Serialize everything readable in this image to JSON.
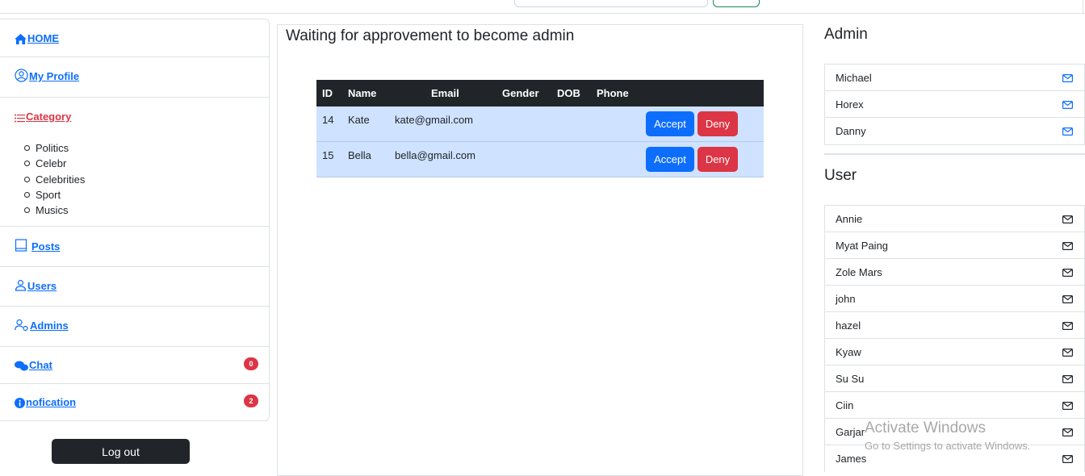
{
  "sidebar": {
    "home": "HOME",
    "profile": "My Profile",
    "category": "Category",
    "categories": [
      "Politics",
      "Celebr",
      "Celebrities",
      "Sport",
      "Musics"
    ],
    "posts": "Posts",
    "users": "Users",
    "admins": "Admins",
    "chat": "Chat",
    "chat_badge": "0",
    "notification": "nofication",
    "notification_badge": "2",
    "logout": "Log out"
  },
  "main": {
    "title": "Waiting for approvement to become admin",
    "columns": [
      "ID",
      "Name",
      "Email",
      "Gender",
      "DOB",
      "Phone"
    ],
    "rows": [
      {
        "id": "14",
        "name": "Kate",
        "email": "kate@gmail.com",
        "gender": "",
        "dob": "",
        "phone": ""
      },
      {
        "id": "15",
        "name": "Bella",
        "email": "bella@gmail.com",
        "gender": "",
        "dob": "",
        "phone": ""
      }
    ],
    "accept_label": "Accept",
    "deny_label": "Deny"
  },
  "admins": {
    "heading": "Admin",
    "items": [
      "Michael",
      "Horex",
      "Danny"
    ]
  },
  "users": {
    "heading": "User",
    "items": [
      "Annie",
      "Myat Paing",
      "Zole Mars",
      "john",
      "hazel",
      "Kyaw",
      "Su Su",
      "Ciin",
      "Garjar",
      "James"
    ]
  },
  "watermark": {
    "line1": "Activate Windows",
    "line2": "Go to Settings to activate Windows."
  },
  "colors": {
    "primary": "#0d6efd",
    "danger": "#dc3545",
    "dark": "#212529",
    "row_bg": "#cfe2ff"
  },
  "icons": {
    "home": "home-icon",
    "profile": "user-circle-icon",
    "category": "list-icon",
    "posts": "book-icon",
    "users": "person-icon",
    "admins": "people-gear-icon",
    "chat": "chat-bubbles-icon",
    "notification": "info-icon",
    "mail": "envelope-icon"
  }
}
